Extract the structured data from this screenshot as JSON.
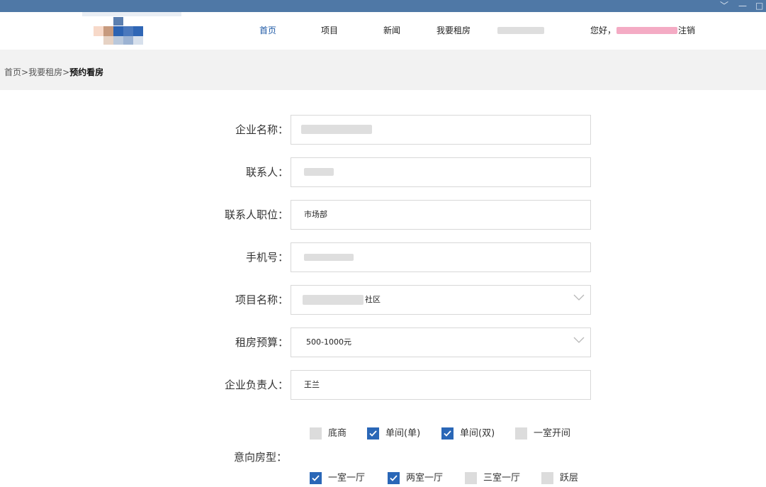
{
  "window": {
    "controls": [
      "﹀",
      "—",
      "□"
    ]
  },
  "nav": {
    "items": [
      {
        "label": "首页",
        "active": true
      },
      {
        "label": "项目",
        "active": false
      },
      {
        "label": "新闻",
        "active": false
      },
      {
        "label": "我要租房",
        "active": false
      }
    ],
    "greeting": "您好，",
    "logout": "注销"
  },
  "breadcrumb": {
    "home": "首页",
    "sep": ">",
    "parent": "我要租房",
    "current": "预约看房"
  },
  "form": {
    "company_name": {
      "label": "企业名称：",
      "value": ""
    },
    "contact": {
      "label": "联系人：",
      "value": ""
    },
    "position": {
      "label": "联系人职位：",
      "value": "市场部"
    },
    "phone": {
      "label": "手机号：",
      "value": ""
    },
    "project": {
      "label": "项目名称：",
      "value": "社区"
    },
    "budget": {
      "label": "租房预算：",
      "value": "500-1000元"
    },
    "owner": {
      "label": "企业负责人：",
      "value": "王兰"
    },
    "room_type": {
      "label": "意向房型：",
      "options": [
        {
          "label": "底商",
          "checked": false
        },
        {
          "label": "单间(单)",
          "checked": true
        },
        {
          "label": "单间(双)",
          "checked": true
        },
        {
          "label": "一室开间",
          "checked": false
        },
        {
          "label": "一室一厅",
          "checked": true
        },
        {
          "label": "两室一厅",
          "checked": true
        },
        {
          "label": "三室一厅",
          "checked": false
        },
        {
          "label": "跃层",
          "checked": false
        }
      ]
    }
  },
  "colors": {
    "titlebar": "#4f78a6",
    "accent": "#2a67b7",
    "breadcrumb_bg": "#f2f2f2"
  }
}
